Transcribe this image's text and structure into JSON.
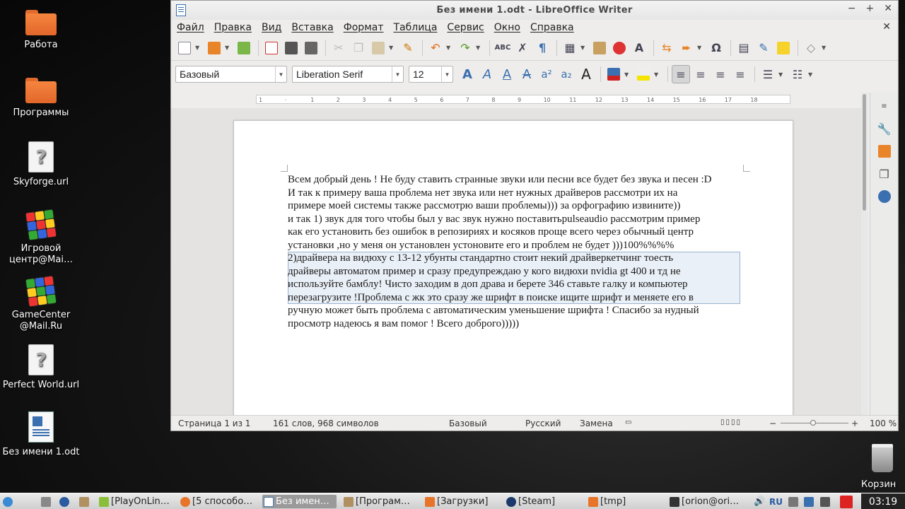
{
  "desktop": {
    "icons": [
      {
        "label": "Работа"
      },
      {
        "label": "Программы"
      },
      {
        "label": "Skyforge.url"
      },
      {
        "label": "Игровой центр@Mai…"
      },
      {
        "label": "GameCenter @Mail.Ru"
      },
      {
        "label": "Perfect World.url"
      },
      {
        "label": "Без имени 1.odt"
      }
    ],
    "trash_label": "Корзин"
  },
  "window": {
    "title": "Без имени 1.odt - LibreOffice Writer",
    "controls": {
      "minimize": "−",
      "maximize": "+",
      "close": "✕"
    },
    "doc_close": "✕"
  },
  "menu": [
    "Файл",
    "Правка",
    "Вид",
    "Вставка",
    "Формат",
    "Таблица",
    "Сервис",
    "Окно",
    "Справка"
  ],
  "formatting": {
    "paragraph_style": "Базовый",
    "font_name": "Liberation Serif",
    "font_size": "12"
  },
  "ruler": {
    "ticks": [
      "1",
      "·",
      "1",
      "2",
      "3",
      "4",
      "5",
      "6",
      "7",
      "8",
      "9",
      "10",
      "11",
      "12",
      "13",
      "14",
      "15",
      "16",
      "17",
      "18"
    ]
  },
  "document": {
    "lines": [
      "Всем добрый день ! Не буду ставить странные звуки или песни все будет без звука и песен :D",
      "И так к примеру ваша проблема нет звука или нет нужных драйверов рассмотри их на",
      "примере моей системы также рассмотрю ваши проблемы))) за орфографию извините))",
      "и так 1) звук для того чтобы был у вас звук нужно поставитьpulseaudio рассмотрим пример",
      "как его установить без ошибок в репозириях и косяков проще всего через обычный центр",
      "установки ,но у меня он установлен устоновите его и проблем не будет )))100%%%%",
      "2)драйвера на видюху с 13-12 убунты стандартно стоит некий драйверкетчинг тоесть",
      "драйверы автоматом пример и сразу предупреждаю у кого видюхи nvidia gt 400 и тд не",
      "используйте бамблу! Чисто заходим в доп драва  и берете 346 ставьте галку и компьютер",
      "перезагрузите !Проблема с жк это сразу же шрифт в поиске ищите шрифт и меняете его в",
      "ручную может быть проблема с автоматическим уменьшение шрифта ! Спасибо за нудный",
      "просмотр надеюсь я вам помог ! Всего доброго)))))"
    ]
  },
  "status": {
    "page": "Страница 1 из 1",
    "words": "161 слов, 968 символов",
    "style": "Базовый",
    "language": "Русский",
    "mode": "Замена",
    "zoom_minus": "−",
    "zoom_plus": "+",
    "zoom": "100 %"
  },
  "taskbar": {
    "tasks": [
      {
        "label": "[PlayOnLin…",
        "color": "#8bbf3a"
      },
      {
        "label": "[5 способо…",
        "color": "#e8742a"
      },
      {
        "label": "Без имен…",
        "color": "#4a7ab8"
      },
      {
        "label": "[Програм…",
        "color": "#b09060"
      },
      {
        "label": "[Загрузки]",
        "color": "#e8742a"
      },
      {
        "label": "[Steam]",
        "color": "#1b3a6b"
      },
      {
        "label": "[tmp]",
        "color": "#e8742a"
      },
      {
        "label": "[orion@ori…",
        "color": "#333333"
      }
    ],
    "lang": "RU",
    "clock": "03:19"
  }
}
